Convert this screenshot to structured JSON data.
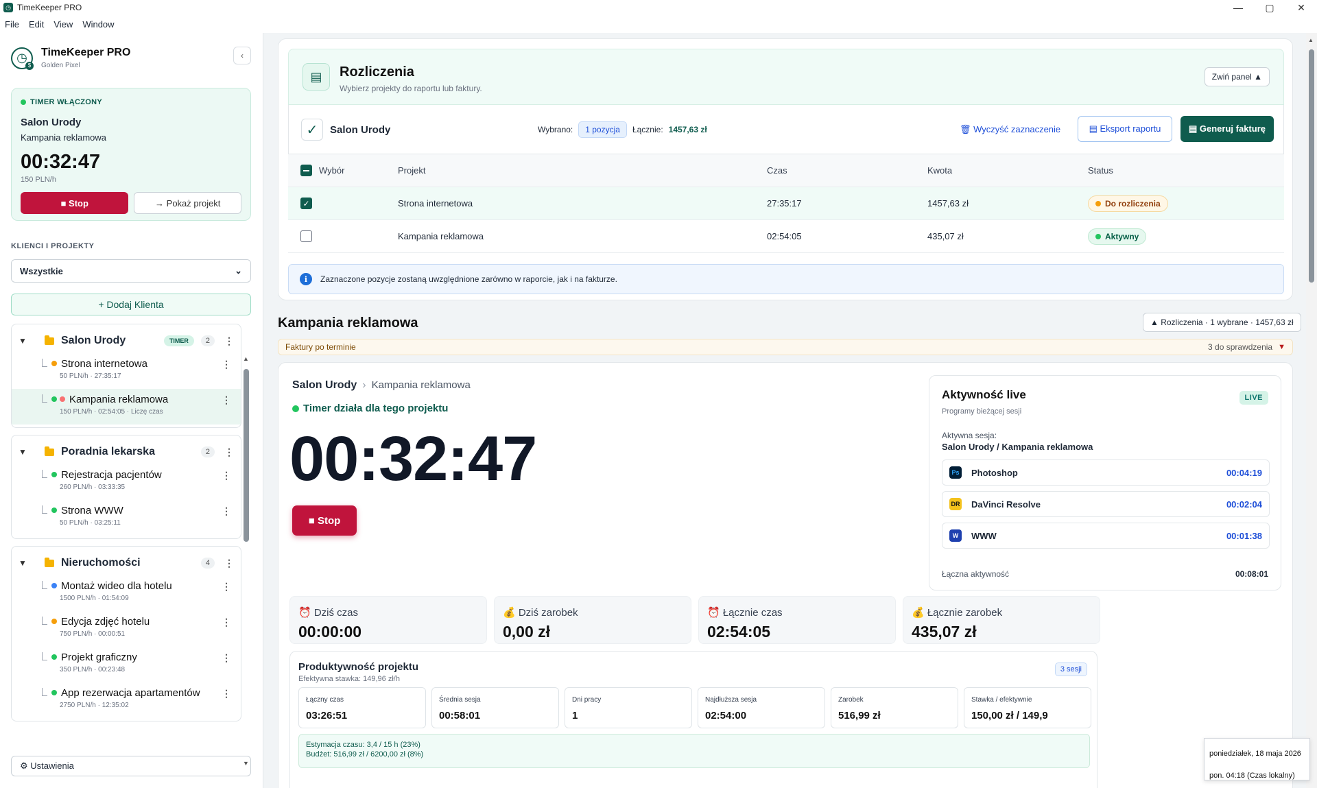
{
  "window": {
    "title": "TimeKeeper PRO",
    "controls": {
      "minimize": "—",
      "maximize": "▢",
      "close": "✕"
    }
  },
  "menu": [
    "File",
    "Edit",
    "View",
    "Window"
  ],
  "sidebar": {
    "brand": "TimeKeeper PRO",
    "workspace": "Golden Pixel",
    "collapse": "‹",
    "timer": {
      "flag": "TIMER WŁĄCZONY",
      "client": "Salon Urody",
      "project": "Kampania reklamowa",
      "time": "00:32:47",
      "rate": "150 PLN/h",
      "stop_label": "■ Stop",
      "show_label": "→ Pokaż projekt"
    },
    "section_label": "KLIENCI I PROJEKTY",
    "filter": "Wszystkie",
    "add_client": "+ Dodaj Klienta",
    "settings": "⚙ Ustawienia",
    "clients": [
      {
        "name": "Salon Urody",
        "badge": "TIMER",
        "count": "2",
        "projects": [
          {
            "name": "Strona internetowa",
            "meta": "50 PLN/h · 27:35:17",
            "dot": "#f59e0b"
          },
          {
            "name": "Kampania reklamowa",
            "meta": "150 PLN/h · 02:54:05 · Liczę czas",
            "dot": "#22c55e",
            "dot2": "#f87171"
          }
        ]
      },
      {
        "name": "Poradnia lekarska",
        "count": "2",
        "projects": [
          {
            "name": "Rejestracja pacjentów",
            "meta": "260 PLN/h · 03:33:35",
            "dot": "#22c55e"
          },
          {
            "name": "Strona WWW",
            "meta": "50 PLN/h · 03:25:11",
            "dot": "#22c55e"
          }
        ]
      },
      {
        "name": "Nieruchomości",
        "count": "4",
        "projects": [
          {
            "name": "Montaż wideo dla hotelu",
            "meta": "1500 PLN/h · 01:54:09",
            "dot": "#3b82f6"
          },
          {
            "name": "Edycja zdjęć hotelu",
            "meta": "750 PLN/h · 00:00:51",
            "dot": "#f59e0b"
          },
          {
            "name": "Projekt graficzny",
            "meta": "350 PLN/h · 00:23:48",
            "dot": "#22c55e"
          },
          {
            "name": "App rezerwacja apartamentów",
            "meta": "2750 PLN/h · 12:35:02",
            "dot": "#22c55e"
          }
        ]
      }
    ]
  },
  "billing": {
    "title": "Rozliczenia",
    "subtitle": "Wybierz projekty do raportu lub faktury.",
    "collapse_label": "Zwiń panel ▲",
    "client": "Salon Urody",
    "selected_label": "Wybrano:",
    "selected_value": "1 pozycja",
    "total_label": "Łącznie:",
    "total_value": "1457,63 zł",
    "clear_label": "🗑 Wyczyść zaznaczenie",
    "export_label": "▤ Eksport raportu",
    "invoice_label": "▤ Generuj fakturę",
    "columns": [
      "Wybór",
      "Projekt",
      "Czas",
      "Kwota",
      "Status"
    ],
    "rows": [
      {
        "project": "Strona internetowa",
        "time": "27:35:17",
        "amount": "1457,63 zł",
        "status": "Do rozliczenia",
        "checked": true
      },
      {
        "project": "Kampania reklamowa",
        "time": "02:54:05",
        "amount": "435,07 zł",
        "status": "Aktywny",
        "checked": false
      }
    ],
    "info": "Zaznaczone pozycje zostaną uwzględnione zarówno w raporcie, jak i na fakturze.",
    "info_icon": "i"
  },
  "project": {
    "title": "Kampania reklamowa",
    "summary_pill": "▲ Rozliczenia · 1 wybrane · 1457,63 zł",
    "overdue_label": "Faktury po terminie",
    "overdue_right": "3 do sprawdzenia",
    "overdue_arrow": "▼",
    "breadcrumb_client": "Salon Urody",
    "breadcrumb_sep": "›",
    "breadcrumb_project": "Kampania reklamowa",
    "running": "Timer działa dla tego projektu",
    "time": "00:32:47",
    "stop_label": "■ Stop",
    "live": {
      "title": "Aktywność live",
      "subtitle": "Programy bieżącej sesji",
      "badge": "LIVE",
      "session_label": "Aktywna sesja:",
      "session": "Salon Urody / Kampania reklamowa",
      "apps": [
        {
          "name": "Photoshop",
          "time": "00:04:19",
          "icon": "Ps"
        },
        {
          "name": "DaVinci Resolve",
          "time": "00:02:04",
          "icon": "DR"
        },
        {
          "name": "WWW",
          "time": "00:01:38",
          "icon": "W"
        }
      ],
      "total_label": "Łączna aktywność",
      "total": "00:08:01"
    },
    "stats": [
      {
        "label": "⏰ Dziś czas",
        "value": "00:00:00"
      },
      {
        "label": "💰 Dziś zarobek",
        "value": "0,00 zł"
      },
      {
        "label": "⏰ Łącznie czas",
        "value": "02:54:05"
      },
      {
        "label": "💰 Łącznie zarobek",
        "value": "435,07 zł"
      }
    ],
    "productivity": {
      "title": "Produktywność projektu",
      "effective": "Efektywna stawka: 149,96 zł/h",
      "sessions": "3 sesji",
      "kpis": [
        {
          "label": "Łączny czas",
          "value": "03:26:51"
        },
        {
          "label": "Średnia sesja",
          "value": "00:58:01"
        },
        {
          "label": "Dni pracy",
          "value": "1"
        },
        {
          "label": "Najdłuższa sesja",
          "value": "02:54:00"
        },
        {
          "label": "Zarobek",
          "value": "516,99 zł"
        },
        {
          "label": "Stawka / efektywnie",
          "value": "150,00 zł / 149,9"
        }
      ],
      "estimate": "Estymacja czasu: 3,4 / 15 h (23%)",
      "budget": "Budżet: 516,99 zł / 6200,00 zł (8%)"
    }
  },
  "tooltip": {
    "date": "poniedziałek, 18 maja 2026",
    "time": "pon. 04:18 (Czas lokalny)"
  }
}
